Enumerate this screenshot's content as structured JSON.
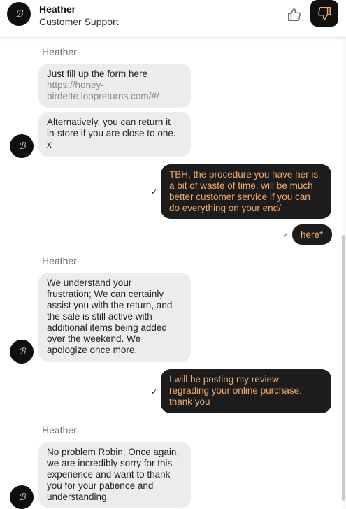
{
  "header": {
    "agent_name": "Heather",
    "agent_role": "Customer Support",
    "avatar_letter": "ℬ",
    "thumb_up_icon": "thumb-up-icon",
    "thumb_down_icon": "thumb-down-icon"
  },
  "colors": {
    "outgoing_bubble": "#1c1c1c",
    "outgoing_text": "#f2a96a",
    "incoming_bubble": "#ececec",
    "link_text": "#8a8a8a"
  },
  "messages": [
    {
      "sender_label": "Heather"
    },
    {
      "text_prefix": "Just fill up the form here",
      "link": "https://honey-\nbirdette.loopreturns.com/#/"
    },
    {
      "text": "Alternatively, you can return it\nin-store if you are close to one.\nx"
    },
    {
      "text": "TBH, the procedure you have her is\na bit of waste of time. will be much\nbetter customer service if you can\ndo everything on your end/",
      "status": "✓"
    },
    {
      "text": "here*",
      "status": "✓"
    },
    {
      "sender_label": "Heather"
    },
    {
      "text": "We understand your\nfrustration;  We can certainly\nassist you with the return, and\nthe sale is still active with\nadditional items being added\nover the weekend. We\napologize once more."
    },
    {
      "text": "I will be posting my review\nregrading your online purchase.\nthank you",
      "status": "✓"
    },
    {
      "sender_label": "Heather"
    },
    {
      "text": "No problem Robin, Once again,\nwe are incredibly sorry for this\nexperience and want to thank\nyou for your patience and\nunderstanding."
    }
  ]
}
